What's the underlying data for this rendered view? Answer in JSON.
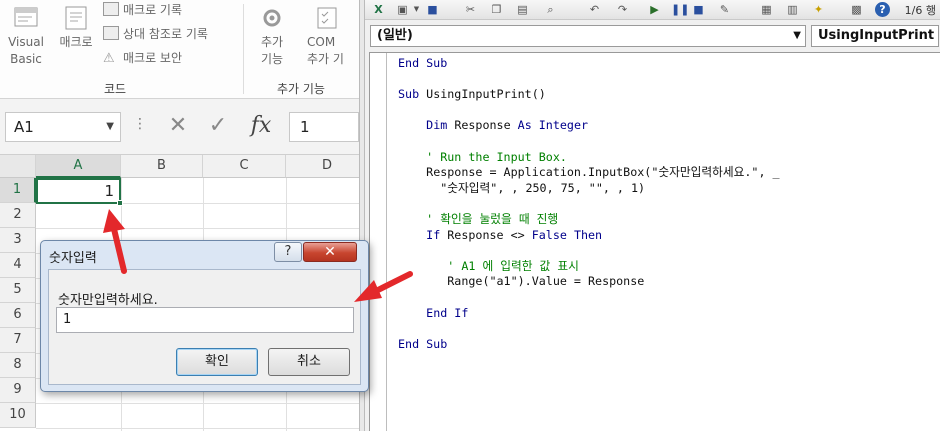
{
  "ribbon": {
    "visual_basic": [
      "Visual",
      "Basic"
    ],
    "macro": "매크로",
    "record_macro": "매크로 기록",
    "relative_ref": "상대 참조로 기록",
    "macro_security": "매크로 보안",
    "code_group": "코드",
    "addins": [
      "추가",
      "기능"
    ],
    "com_addins": [
      "COM",
      "추가 기"
    ],
    "addins_group": "추가 기능"
  },
  "formula_bar": {
    "name_box": "A1",
    "fx": "fx",
    "value": "1"
  },
  "sheet": {
    "columns": [
      "A",
      "B",
      "C",
      "D"
    ],
    "rows": [
      "1",
      "2",
      "3",
      "4",
      "5",
      "6",
      "7",
      "8",
      "9",
      "10"
    ],
    "a1_value": "1"
  },
  "dialog": {
    "title": "숫자입력",
    "help": "?",
    "close": "✕",
    "prompt": "숫자만입력하세요.",
    "input_value": "1",
    "ok": "확인",
    "cancel": "취소"
  },
  "vbe": {
    "object_combo": "(일반)",
    "proc_combo": "UsingInputPrint",
    "toolbar_pos": "1/6 행",
    "code": [
      {
        "kw": "End Sub",
        "rest": ""
      },
      {
        "blank": true
      },
      {
        "kw": "Sub",
        "rest": " UsingInputPrint()"
      },
      {
        "blank": true
      },
      {
        "indent": "    ",
        "kw": "Dim",
        "rest": " Response ",
        "kw2": "As Integer"
      },
      {
        "blank": true
      },
      {
        "indent": "    ",
        "cm": "' Run the Input Box."
      },
      {
        "indent": "    ",
        "rest": "Response = Application.InputBox(\"숫자만입력하세요.\", _"
      },
      {
        "indent": "      ",
        "rest": "\"숫자입력\", , 250, 75, \"\", , 1)"
      },
      {
        "blank": true
      },
      {
        "indent": "    ",
        "cm": "' 확인을 눌렀을 때 진행"
      },
      {
        "indent": "    ",
        "kw": "If",
        "rest": " Response <> ",
        "kw2": "False Then"
      },
      {
        "blank": true
      },
      {
        "indent": "       ",
        "cm": "' A1 에 입력한 값 표시"
      },
      {
        "indent": "       ",
        "rest": "Range(\"a1\").Value = Response"
      },
      {
        "blank": true
      },
      {
        "indent": "    ",
        "kw": "End If",
        "rest": ""
      },
      {
        "blank": true
      },
      {
        "kw": "End Sub",
        "rest": ""
      }
    ]
  },
  "colors": {
    "excel_green": "#217346",
    "keyword": "#00008b",
    "comment": "#008000",
    "arrow": "#e3282b"
  }
}
